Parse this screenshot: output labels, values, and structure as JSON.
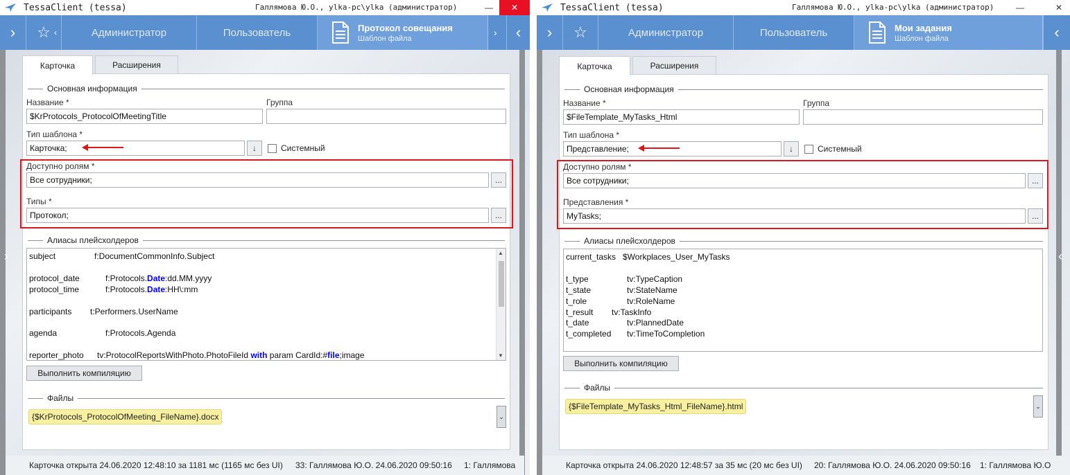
{
  "windows": [
    {
      "app_title": "TessaClient (tessa)",
      "user_info": "Галлямова Ю.О., ylka-pc\\ylka (администратор)",
      "nav": {
        "tab_admin": "Администратор",
        "tab_user": "Пользователь",
        "active_title": "Протокол совещания",
        "active_subtitle": "Шаблон файла"
      },
      "tabs": {
        "card": "Карточка",
        "extensions": "Расширения"
      },
      "section_main": "Основная информация",
      "name_label": "Название *",
      "name_value": "$KrProtocols_ProtocolOfMeetingTitle",
      "group_label": "Группа",
      "group_value": "",
      "template_type_label": "Тип шаблона *",
      "template_type_value": "Карточка;",
      "system_label": "Системный",
      "roles_label": "Доступно ролям *",
      "roles_value": "Все сотрудники;",
      "second_label": "Типы *",
      "second_value": "Протокол;",
      "ellipsis": "...",
      "section_aliases": "Алиасы плейсхолдеров",
      "compile_button": "Выполнить компиляцию",
      "section_files": "Файлы",
      "file_name": "{$KrProtocols_ProtocolOfMeeting_FileName}.docx",
      "status": {
        "opened": "Карточка открыта 24.06.2020 12:48:10 за 1181 мс (1165 мс без UI)",
        "user": "33:  Галлямова Ю.О.  24.06.2020 09:50:16",
        "extra": "1:  Галлямова"
      }
    },
    {
      "app_title": "TessaClient (tessa)",
      "user_info": "Галлямова Ю.О., ylka-pc\\ylka (администратор)",
      "nav": {
        "tab_admin": "Администратор",
        "tab_user": "Пользователь",
        "active_title": "Мои задания",
        "active_subtitle": "Шаблон файла"
      },
      "tabs": {
        "card": "Карточка",
        "extensions": "Расширения"
      },
      "section_main": "Основная информация",
      "name_label": "Название *",
      "name_value": "$FileTemplate_MyTasks_Html",
      "group_label": "Группа",
      "group_value": "",
      "template_type_label": "Тип шаблона *",
      "template_type_value": "Представление;",
      "system_label": "Системный",
      "roles_label": "Доступно ролям *",
      "roles_value": "Все сотрудники;",
      "second_label": "Представления *",
      "second_value": "MyTasks;",
      "ellipsis": "...",
      "section_aliases": "Алиасы плейсхолдеров",
      "compile_button": "Выполнить компиляцию",
      "section_files": "Файлы",
      "file_name": "{$FileTemplate_MyTasks_Html_FileName}.html",
      "status": {
        "opened": "Карточка открыта 24.06.2020 12:48:57 за 35 мс (20 мс без UI)",
        "user": "20:  Галлямова Ю.О.  24.06.2020 09:50:16",
        "extra": "1:  Галлямова Ю.О"
      }
    }
  ],
  "aliases_left": [
    {
      "key": "subject",
      "p1": "f:DocumentCommonInfo.Subject",
      "kw": "",
      "p2": "",
      "kw2": "",
      "p3": ""
    },
    {
      "key": "protocol_date",
      "p1": "f:Protocols.",
      "kw": "Date",
      "p2": ":dd.MM.yyyy",
      "kw2": "",
      "p3": ""
    },
    {
      "key": "protocol_time",
      "p1": "f:Protocols.",
      "kw": "Date",
      "p2": ":HH\\:mm",
      "kw2": "",
      "p3": ""
    },
    {
      "key": "participants",
      "p1": "t:Performers.UserName",
      "kw": "",
      "p2": "",
      "kw2": "",
      "p3": ""
    },
    {
      "key": "agenda",
      "p1": "f:Protocols.Agenda",
      "kw": "",
      "p2": "",
      "kw2": "",
      "p3": ""
    },
    {
      "key": "reporter_photo",
      "p1": "tv:ProtocolReportsWithPhoto.PhotoFileId ",
      "kw": "with",
      "p2": " param CardId:#",
      "kw2": "file",
      "p3": ";image"
    }
  ],
  "aliases_right": [
    {
      "key": "current_tasks",
      "val": "$Workplaces_User_MyTasks"
    },
    {
      "key": "t_type",
      "val": "tv:TypeCaption"
    },
    {
      "key": "t_state",
      "val": "tv:StateName"
    },
    {
      "key": "t_role",
      "val": "tv:RoleName"
    },
    {
      "key": "t_result",
      "val": "tv:TaskInfo"
    },
    {
      "key": "t_date",
      "val": "tv:PlannedDate"
    },
    {
      "key": "t_completed",
      "val": "tv:TimeToCompletion"
    }
  ],
  "icons": [
    "chevron-right-icon",
    "star-icon",
    "document-icon",
    "chevron-left-icon",
    "down-arrow-icon",
    "minimize-icon",
    "close-icon",
    "dropdown-icon",
    "bird-logo-icon"
  ],
  "colors": {
    "nav_bg": "#5a8fd0",
    "highlight": "#e0141b",
    "file_chip": "#f7f0a0",
    "keyword": "#0000ff"
  }
}
